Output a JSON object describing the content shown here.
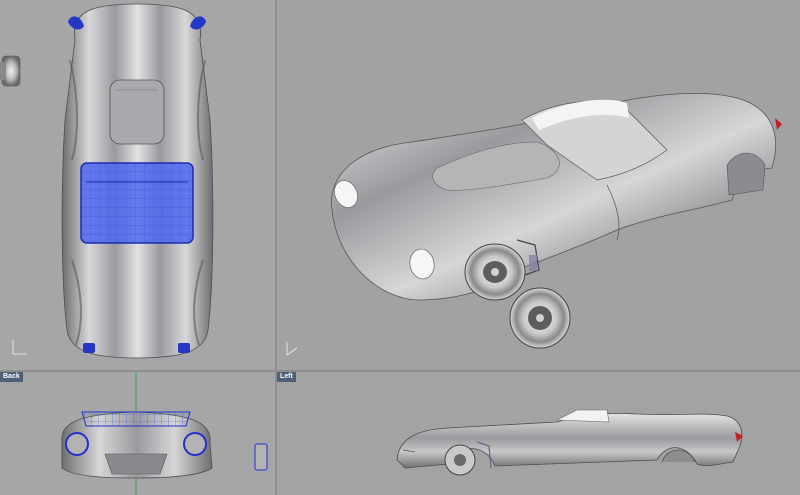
{
  "viewports": {
    "top": {
      "label": ""
    },
    "perspective": {
      "label": ""
    },
    "back": {
      "label": "Back"
    },
    "left": {
      "label": "Left"
    }
  },
  "colors": {
    "viewport_bg": "#a3a3a3",
    "active_tab": "#4d6077",
    "selection_blue": "#2a3fd0",
    "car_body": "#c9c9cb",
    "tail_light": "#c4202a"
  },
  "icons": {
    "axis_widget": "axis-triad-icon"
  }
}
